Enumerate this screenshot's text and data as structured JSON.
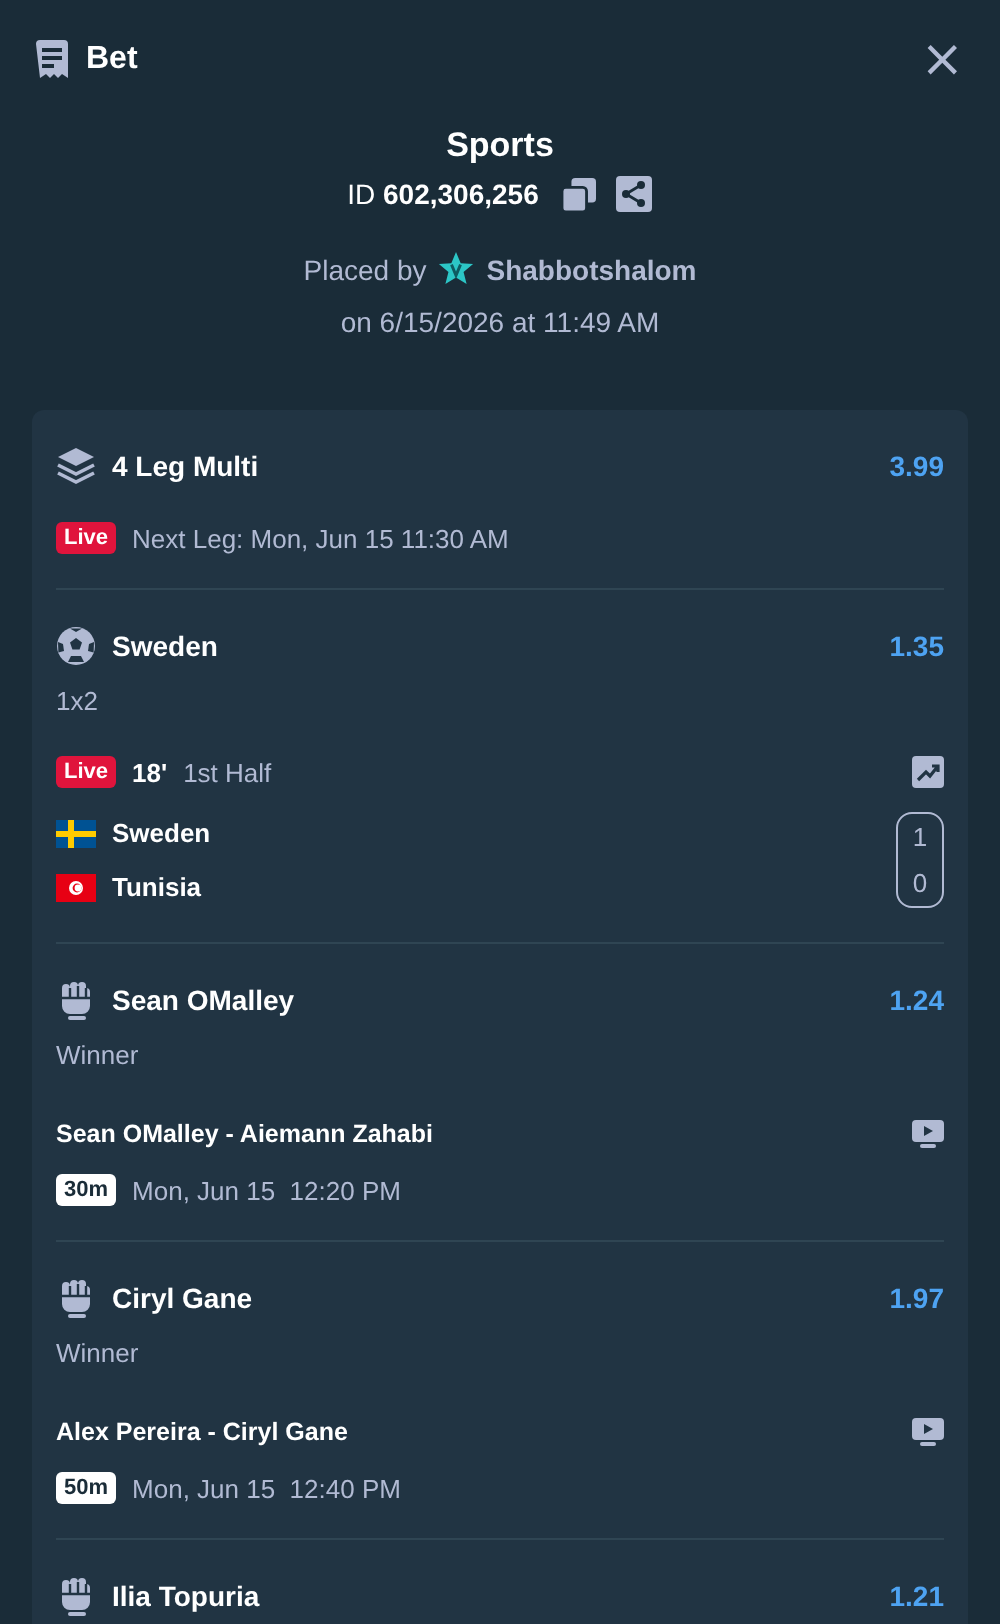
{
  "header": {
    "title": "Bet",
    "close": "×"
  },
  "summary": {
    "category": "Sports",
    "id_label": "ID",
    "id_value": "602,306,256",
    "placed_by": "Placed by",
    "user": "Shabbotshalom",
    "placed_on": "on 6/15/2026 at 11:49 AM"
  },
  "legs": [
    {
      "kind": "multi",
      "title": "4 Leg Multi",
      "odds": "3.99",
      "live": true,
      "live_label": "Live",
      "note": "Next Leg: Mon, Jun 15 11:30 AM"
    },
    {
      "kind": "football",
      "title": "Sweden",
      "odds": "1.35",
      "market": "1x2",
      "live": true,
      "live_label": "Live",
      "minute": "18'",
      "period": "1st Half",
      "teams": [
        {
          "name": "Sweden",
          "kind": "sweden",
          "score": "1"
        },
        {
          "name": "Tunisia",
          "kind": "tunisia",
          "score": "0"
        }
      ]
    },
    {
      "kind": "mma",
      "title": "Sean OMalley",
      "odds": "1.24",
      "market": "Winner",
      "match": "Sean OMalley - Aiemann Zahabi",
      "countdown": "30m",
      "start": "Mon, Jun 15  12:20 PM"
    },
    {
      "kind": "mma",
      "title": "Ciryl Gane",
      "odds": "1.97",
      "market": "Winner",
      "match": "Alex Pereira - Ciryl Gane",
      "countdown": "50m",
      "start": "Mon, Jun 15  12:40 PM"
    },
    {
      "kind": "mma",
      "title": "Ilia Topuria",
      "odds": "1.21"
    }
  ]
}
